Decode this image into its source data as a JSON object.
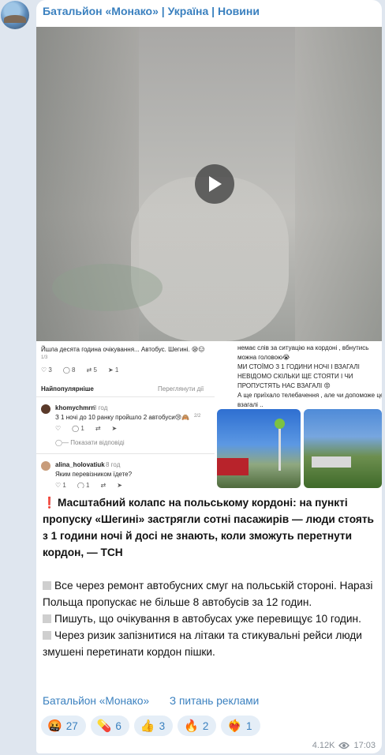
{
  "post": {
    "channel_name": "Батальйон «Монако» | Україна | Новини",
    "views": "4.12K",
    "time": "17:03"
  },
  "collage": {
    "left": {
      "line1": "Йшла десята година очікування... Автобус. Шегині. 😪😑",
      "line2": "1/3",
      "counts": [
        "3",
        "8",
        "5",
        "1"
      ],
      "sort_label": "Найпопулярніше",
      "view_activity": "Переглянути дії",
      "c1_user": "khomychmrn",
      "c1_time": "8 год",
      "c1_text": "З 1 ночі до 10 ранку пройшло 2 автобуси😢🙈",
      "c1_page": "2/2",
      "c1_count": "1",
      "show_replies": "Показати відповіді",
      "c2_user": "alina_holovatiuk",
      "c2_time": "8 год",
      "c2_text": "Яким перевізником їдете?",
      "c2_count1": "1",
      "c2_count2": "1"
    },
    "right": {
      "l1": "немає слів за ситуацію на кордоні , вбнутись",
      "l2": "можна головою😭",
      "l3": "МИ СТОЇМО З 1 ГОДИНИ НОЧІ І ВЗАГАЛІ",
      "l4": "НЕВІДОМО СКІЛЬКИ ЩЕ СТОЯТИ І ЧИ",
      "l5": "ПРОПУСТЯТЬ НАС ВЗАГАЛІ 😡",
      "l6": "А ще приїхало телебачення , але чи допоможе це",
      "l7": "взагалі .."
    }
  },
  "message": {
    "headline": "Масштабний колапс на польському кордоні: на пункті пропуску «Шегині» застрягли сотні пасажирів — люди стоять з 1 години ночі й досі не знають, коли зможуть перетнути кордон, — ТСН",
    "b1": "Все через ремонт автобусних смуг на польській стороні. Наразі Польща пропускає не більше 8 автобусів за 12 годин.",
    "b2": "Пишуть, що очікування в автобусах уже перевищує 10 годин.",
    "b3": "Через ризик запізнитися на літаки та стикувальні рейси люди змушені перетинати кордон пішки.",
    "link1": "Батальйон «Монако»",
    "link2": "З питань реклами"
  },
  "reactions": [
    {
      "emoji": "🤬",
      "count": "27"
    },
    {
      "emoji": "💊",
      "count": "6"
    },
    {
      "emoji": "👍",
      "count": "3"
    },
    {
      "emoji": "🔥",
      "count": "2"
    },
    {
      "emoji": "❤️‍🔥",
      "count": "1"
    }
  ],
  "colors": {
    "accent": "#3a80bf",
    "chat_bg": "#dfe6ef",
    "reaction_bg": "#e5eef7"
  }
}
